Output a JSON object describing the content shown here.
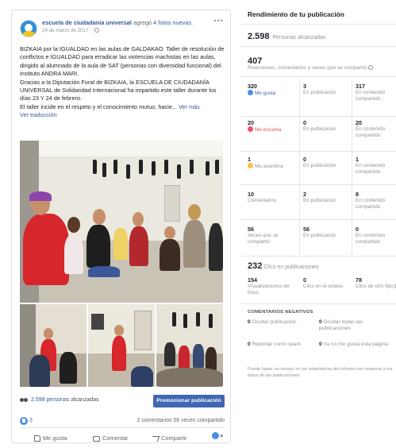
{
  "post": {
    "page_name": "escuela de ciudadanía universal",
    "action": "agregó",
    "album_link": "4 fotos nuevas.",
    "date": "24 de marzo de 2017 ·",
    "text_p1": "BIZKAIA por la IGUALDAD en las aulas de GALDAKAO. Taller de resolución de conflictos e IGUALDAD para erradicar las violencias machistas en las aulas, dirigido al alumnado de la aula de SAT (personas con diversidad funcional) del instituto ANDRA MARI.",
    "text_p2": "Gracias a la Diputación Foral de BIZKAIA, la ESCUELA DE CIUDADANÍA UNIVERSAL de Solidaridad Internacional ha impartido este taller durante los días 23 Y 24 de febrero.",
    "text_p3": "El taller incide en el respeto y el conocimiento mutuo, hacie...",
    "see_more": "Ver más",
    "translate": "Ver traducción",
    "reach_number": "2.598 personas",
    "reach_label": "alcanzadas",
    "promote_button": "Promocionar publicación",
    "like_count": "3",
    "counts": "2 comentarios 56 veces compartido",
    "actions": {
      "like": "Me gusta",
      "comment": "Comentar",
      "share": "Compartir"
    },
    "icons": [
      "globe-icon",
      "more-icon",
      "people-icon",
      "like-icon",
      "thumb-icon",
      "comment-icon",
      "share-icon",
      "audience-icon"
    ]
  },
  "insights": {
    "title": "Rendimiento de tu publicación",
    "reach_number": "2.598",
    "reach_label": "Personas alcanzadas",
    "reactions_number": "407",
    "reactions_label": "Reacciones, comentarios y veces que se compartió",
    "rows": [
      [
        {
          "num": "320",
          "label": "Me gusta",
          "icon": "like"
        },
        {
          "num": "3",
          "label": "En publicación"
        },
        {
          "num": "317",
          "label": "En contenido compartido"
        }
      ],
      [
        {
          "num": "20",
          "label": "Me encanta",
          "icon": "love"
        },
        {
          "num": "0",
          "label": "En publicación"
        },
        {
          "num": "20",
          "label": "En contenido compartido"
        }
      ],
      [
        {
          "num": "1",
          "label": "Me asombra",
          "icon": "wow"
        },
        {
          "num": "0",
          "label": "En publicación"
        },
        {
          "num": "1",
          "label": "En contenido compartido"
        }
      ],
      [
        {
          "num": "10",
          "label": "Comentarios"
        },
        {
          "num": "2",
          "label": "En publicación"
        },
        {
          "num": "8",
          "label": "En contenido compartido"
        }
      ],
      [
        {
          "num": "56",
          "label": "Veces que se compartió"
        },
        {
          "num": "56",
          "label": "En publicación"
        },
        {
          "num": "0",
          "label": "En contenido compartido"
        }
      ]
    ],
    "clicks_number": "232",
    "clicks_label": "Clics en publicaciones",
    "clicks": [
      {
        "num": "154",
        "label": "Visualizaciones de fotos"
      },
      {
        "num": "0",
        "label": "Clics en el enlace"
      },
      {
        "num": "78",
        "label": "Clics de otro tipo"
      }
    ],
    "negative_title": "COMENTARIOS NEGATIVOS",
    "negative": [
      {
        "num": "0",
        "label": "Ocultar publicación"
      },
      {
        "num": "0",
        "label": "Ocultar todas las publicaciones"
      },
      {
        "num": "0",
        "label": "Reportar como spam"
      },
      {
        "num": "0",
        "label": "Ya no me gusta esta página"
      }
    ],
    "footnote": "Puede haber un retraso en las estadísticas del informe con respecto a los datos de las publicaciones"
  },
  "colors": {
    "brand_blue": "#4267b2",
    "link_blue": "#365899",
    "muted": "#90949c",
    "love_red": "#e9555c"
  }
}
